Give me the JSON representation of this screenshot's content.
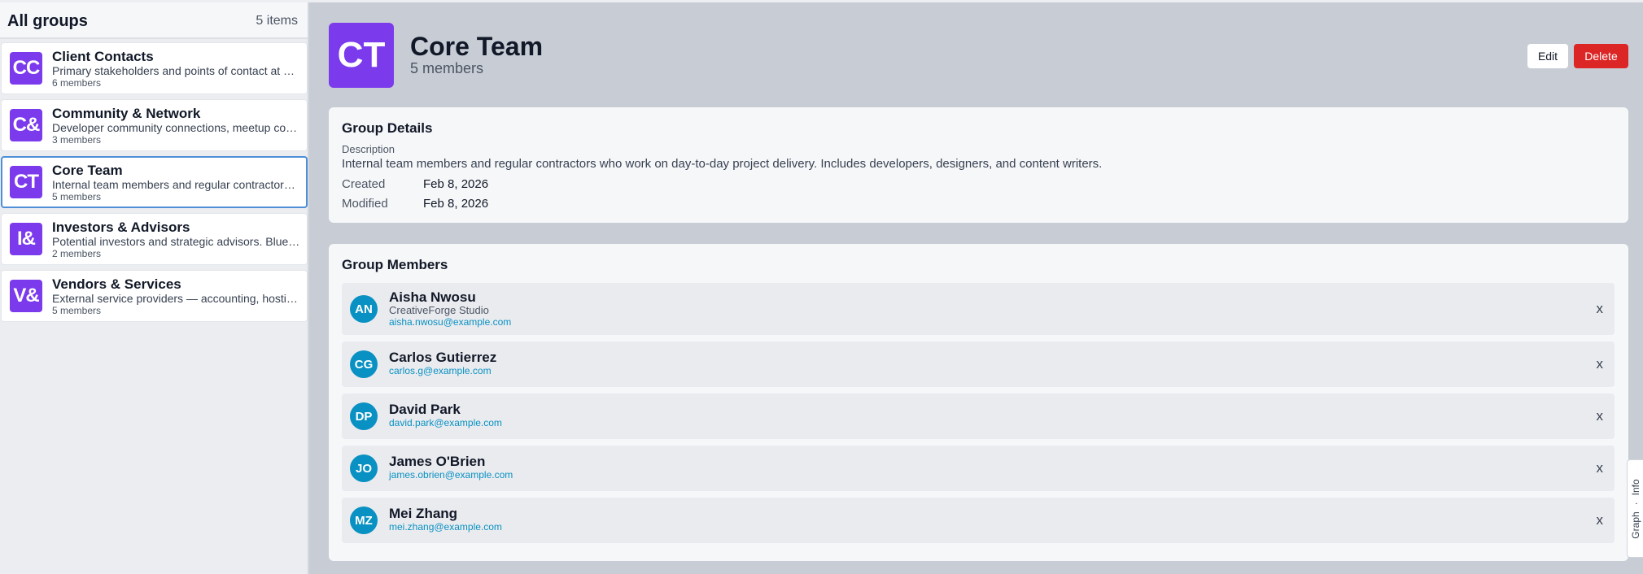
{
  "sidebar": {
    "title": "All groups",
    "count": "5 items",
    "groups": [
      {
        "initials": "CC",
        "name": "Client Contacts",
        "description": "Primary stakeholders and points of contact at client organizations.",
        "members": "6 members"
      },
      {
        "initials": "C&",
        "name": "Community & Network",
        "description": "Developer community connections, meetup contacts, and conference friends.",
        "members": "3 members"
      },
      {
        "initials": "CT",
        "name": "Core Team",
        "description": "Internal team members and regular contractors who work on day-to-day project delivery.",
        "members": "5 members"
      },
      {
        "initials": "I&",
        "name": "Investors & Advisors",
        "description": "Potential investors and strategic advisors. Blue-sky relationships.",
        "members": "2 members"
      },
      {
        "initials": "V&",
        "name": "Vendors & Services",
        "description": "External service providers — accounting, hosting, legal and more.",
        "members": "5 members"
      }
    ]
  },
  "header": {
    "initials": "CT",
    "title": "Core Team",
    "subtitle": "5 members",
    "edit_label": "Edit",
    "delete_label": "Delete"
  },
  "details": {
    "title": "Group Details",
    "description_label": "Description",
    "description": "Internal team members and regular contractors who work on day-to-day project delivery. Includes developers, designers, and content writers.",
    "created_label": "Created",
    "created": "Feb 8, 2026",
    "modified_label": "Modified",
    "modified": "Feb 8, 2026"
  },
  "members": {
    "title": "Group Members",
    "remove_label": "x",
    "items": [
      {
        "initials": "AN",
        "name": "Aisha Nwosu",
        "company": "CreativeForge Studio",
        "email": "aisha.nwosu@example.com"
      },
      {
        "initials": "CG",
        "name": "Carlos Gutierrez",
        "company": "",
        "email": "carlos.g@example.com"
      },
      {
        "initials": "DP",
        "name": "David Park",
        "company": "",
        "email": "david.park@example.com"
      },
      {
        "initials": "JO",
        "name": "James O'Brien",
        "company": "",
        "email": "james.obrien@example.com"
      },
      {
        "initials": "MZ",
        "name": "Mei Zhang",
        "company": "",
        "email": "mei.zhang@example.com"
      }
    ]
  },
  "sidetab": {
    "graph_label": "Graph",
    "separator": "·",
    "info_label": "Info"
  },
  "colors": {
    "group_avatar": "#7c3aed",
    "member_avatar": "#0891c2",
    "delete_button": "#dc2626",
    "selected_border": "#4f8fd8"
  }
}
